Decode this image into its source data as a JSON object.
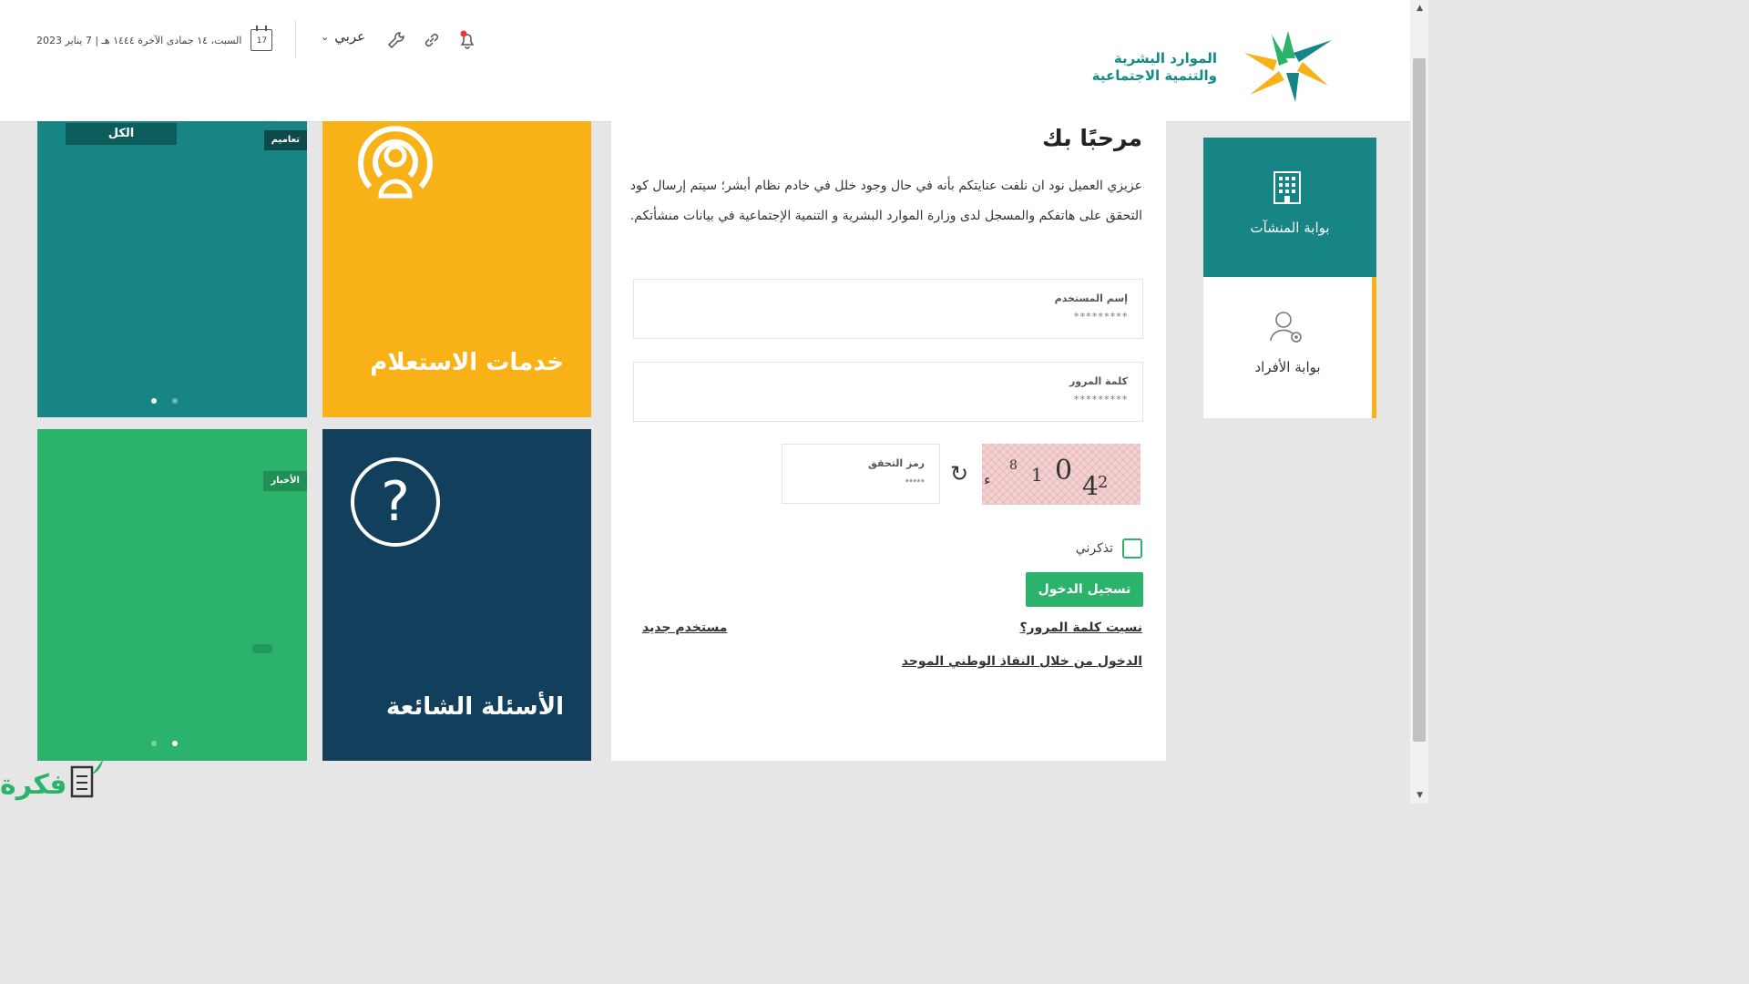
{
  "header": {
    "logo_line1": "الموارد البشرية",
    "logo_line2": "والتنمية الاجتماعية",
    "date_text": "السبت، ١٤ جمادى الآخرة ١٤٤٤ هـ | 7 يناير 2023",
    "calendar_day": "17",
    "language_label": "عربي",
    "colors": {
      "brand_teal": "#128a86",
      "alert_red": "#e53935"
    }
  },
  "tiles": {
    "all_label": "الكل",
    "circulars_label": "تعاميم",
    "news_label": "الأخبار",
    "inquiry_title": "خدمات الاستعلام",
    "faq_title": "الأسئلة الشائعة",
    "faq_icon_glyph": "?",
    "colors": {
      "teal": "#178585",
      "yellow": "#f8b217",
      "green": "#2bb36b",
      "navy": "#12405c"
    }
  },
  "login": {
    "welcome": "مرحبًا بك",
    "intro": "عزيزي العميل نود ان نلفت عنايتكم بأنه في حال وجود خلل في خادم نظام أبشر؛ سيتم إرسال كود التحقق على هاتفكم والمسجل لدى وزارة الموارد البشرية و التنمية الإجتماعية في بيانات منشأتكم.",
    "username_label": "إسم المستخدم",
    "username_value": "*********",
    "password_label": "كلمة المرور",
    "password_value": "*********",
    "captcha_label": "رمز التحقق",
    "captcha_value": "*****",
    "captcha_chars": [
      "ء",
      "8",
      "1",
      "0",
      "4",
      "2"
    ],
    "remember_label": "تذكرني",
    "login_button": "تسجيل الدخول",
    "forgot_password": "نسيت كلمة المرور؟",
    "new_user": "مستخدم جديد",
    "national_sso": "الدخول من خلال النفاذ الوطني الموحد"
  },
  "portals": {
    "establishments": "بوابة المنشآت",
    "individuals": "بوابة الأفراد"
  },
  "watermark": {
    "text": "فكرة"
  }
}
